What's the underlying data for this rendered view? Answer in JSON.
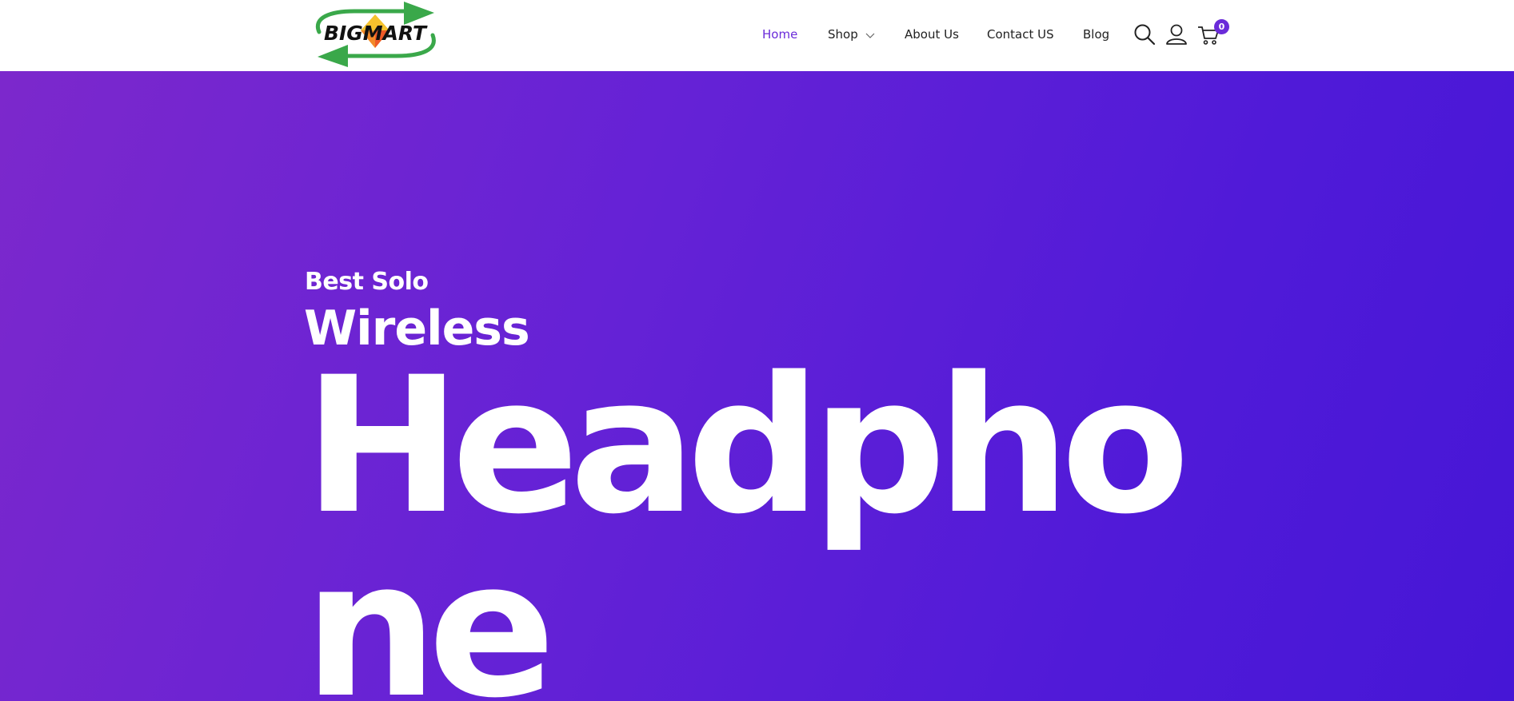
{
  "header": {
    "logo_text": "BIGMART",
    "nav": [
      {
        "label": "Home",
        "active": true
      },
      {
        "label": "Shop",
        "has_dropdown": true
      },
      {
        "label": "About Us"
      },
      {
        "label": "Contact US"
      },
      {
        "label": "Blog"
      }
    ],
    "icons": [
      "search-icon",
      "user-icon",
      "cart-icon"
    ],
    "cart_count": "0"
  },
  "hero": {
    "subtitle": "Best Solo",
    "title": "Wireless",
    "headline": "Headphone"
  },
  "colors": {
    "accent": "#6a2bd9",
    "hero_gradient_start": "#7c28cc",
    "hero_gradient_end": "#4616d6",
    "logo_green": "#3aa84a"
  }
}
